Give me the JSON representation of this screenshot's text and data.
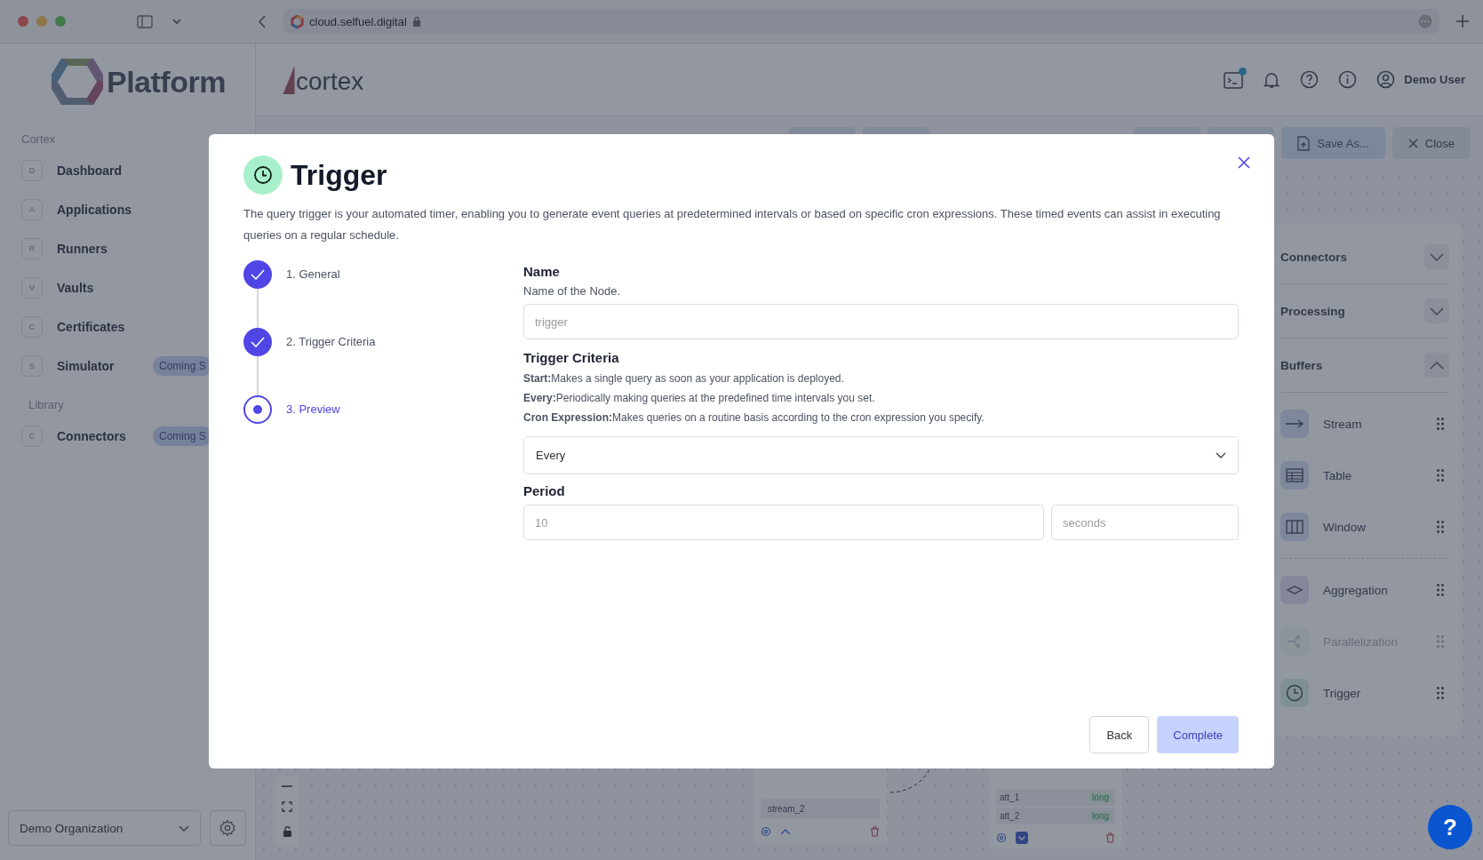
{
  "browser": {
    "url": "cloud.selfuel.digital"
  },
  "sidebar": {
    "logo": "Platform",
    "sections": [
      {
        "title": "Cortex",
        "items": [
          {
            "letter": "D",
            "label": "Dashboard"
          },
          {
            "letter": "A",
            "label": "Applications"
          },
          {
            "letter": "R",
            "label": "Runners"
          },
          {
            "letter": "V",
            "label": "Vaults"
          },
          {
            "letter": "C",
            "label": "Certificates"
          },
          {
            "letter": "S",
            "label": "Simulator",
            "badge": "Coming S"
          }
        ]
      },
      {
        "title": "Library",
        "items": [
          {
            "letter": "C",
            "label": "Connectors",
            "badge": "Coming S"
          }
        ]
      }
    ],
    "organization": "Demo Organization"
  },
  "header": {
    "logo": "cortex",
    "terminal_dot": true,
    "user": "Demo User"
  },
  "toolbar": {
    "buttons": [
      {
        "kind": "save",
        "label": "Save As..."
      },
      {
        "kind": "close",
        "label": "Close"
      }
    ]
  },
  "palette": {
    "sections": [
      {
        "title": "Connectors",
        "expanded": false
      },
      {
        "title": "Processing",
        "expanded": false
      },
      {
        "title": "Buffers",
        "expanded": true,
        "groups": [
          {
            "items": [
              {
                "kind": "stream",
                "label": "Stream",
                "disabled": false
              },
              {
                "kind": "table",
                "label": "Table",
                "disabled": false
              },
              {
                "kind": "window",
                "label": "Window",
                "disabled": false
              }
            ]
          },
          {
            "items": [
              {
                "kind": "aggregation",
                "label": "Aggregation",
                "disabled": false
              },
              {
                "kind": "parallelization",
                "label": "Parallelization",
                "disabled": true
              },
              {
                "kind": "trigger",
                "label": "Trigger",
                "disabled": false
              }
            ]
          }
        ]
      }
    ]
  },
  "canvas": {
    "stream_node": {
      "field": "stream_2"
    },
    "table_node": {
      "rows": [
        {
          "name": "att_1",
          "type": "long"
        },
        {
          "name": "att_2",
          "type": "long"
        }
      ]
    }
  },
  "help_button": "?",
  "modal": {
    "title": "Trigger",
    "description": "The query trigger is your automated timer, enabling you to generate event queries at predetermined intervals or based on specific cron expressions. These timed events can assist in executing queries on a regular schedule.",
    "steps": [
      {
        "label": "1. General",
        "completed": true,
        "selected": false
      },
      {
        "label": "2. Trigger Criteria",
        "completed": true,
        "selected": false
      },
      {
        "label": "3. Preview",
        "completed": false,
        "selected": true
      }
    ],
    "name": {
      "label": "Name",
      "hint": "Name of the Node.",
      "placeholder": "trigger"
    },
    "criteria": {
      "label": "Trigger Criteria",
      "lines": [
        "**Start:**Makes a single query as soon as your application is deployed.",
        "**Every:**Periodically making queries at the predefined time intervals you set.",
        "**Cron Expression:**Makes queries on a routine basis according to the cron expression you specify."
      ],
      "value": "Every"
    },
    "period": {
      "label": "Period",
      "placeholder": "10",
      "unit_placeholder": "seconds"
    },
    "buttons": [
      {
        "kind": "secondary",
        "label": "Back"
      },
      {
        "kind": "primary",
        "label": "Complete"
      }
    ]
  }
}
